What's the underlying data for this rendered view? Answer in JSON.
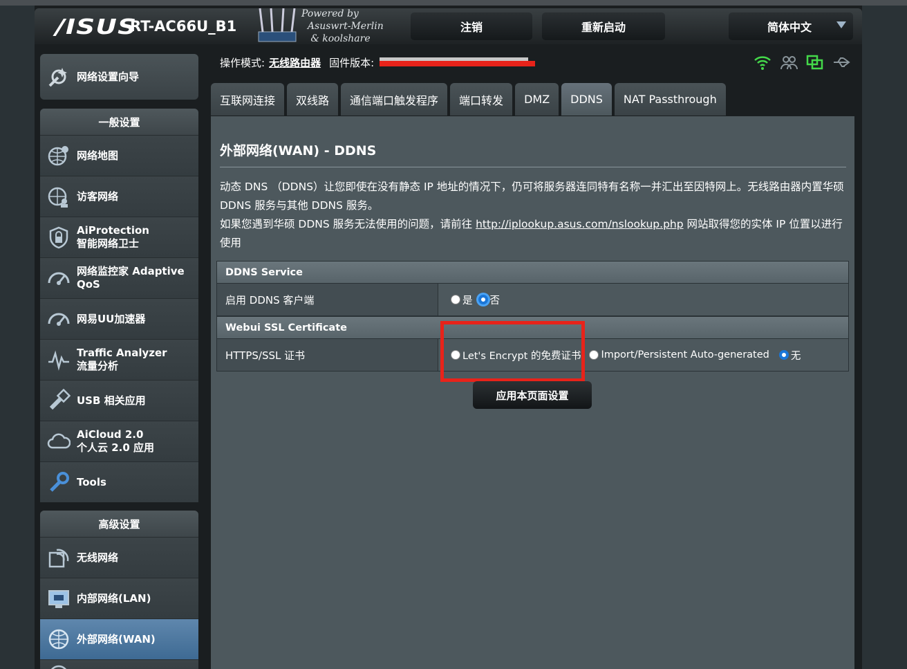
{
  "header": {
    "brand": "/ISUS",
    "model": "RT-AC66U_B1",
    "powered_by": "Powered by\n  Asuswrt-Merlin\n   & koolshare",
    "logout_label": "注销",
    "reboot_label": "重新启动",
    "language": "简体中文"
  },
  "sidebar": {
    "wizard_label": "网络设置向导",
    "general_title": "一般设置",
    "general_items": [
      {
        "label": "网络地图"
      },
      {
        "label": "访客网络"
      },
      {
        "label": "AiProtection\n智能网络卫士"
      },
      {
        "label": "网络监控家 Adaptive\nQoS"
      },
      {
        "label": "网易UU加速器"
      },
      {
        "label": "Traffic Analyzer\n流量分析"
      },
      {
        "label": "USB 相关应用"
      },
      {
        "label": "AiCloud 2.0\n个人云 2.0 应用"
      },
      {
        "label": "Tools"
      }
    ],
    "advanced_title": "高级设置",
    "advanced_items": [
      {
        "label": "无线网络"
      },
      {
        "label": "内部网络(LAN)"
      },
      {
        "label": "外部网络(WAN)",
        "active": true
      }
    ]
  },
  "status": {
    "mode_label": "操作模式:",
    "mode_value": "无线路由器",
    "firmware_label": "固件版本:"
  },
  "tabs": [
    "互联网连接",
    "双线路",
    "通信端口触发程序",
    "端口转发",
    "DMZ",
    "DDNS",
    "NAT Passthrough"
  ],
  "active_tab": "DDNS",
  "page": {
    "title": "外部网络(WAN) - DDNS",
    "desc1": "动态 DNS （DDNS）让您即使在没有静态 IP 地址的情况下，仍可将服务器连同特有名称一并汇出至因特网上。无线路由器内置华硕 DDNS 服务与其他 DDNS 服务。",
    "desc2_pre": "如果您遇到华硕 DDNS 服务无法使用的问题，请前往 ",
    "desc2_link": "http://iplookup.asus.com/nslookup.php",
    "desc2_post": " 网站取得您的实体 IP 位置以进行使用"
  },
  "ddns_section": {
    "header": "DDNS Service",
    "enable_label": "启用 DDNS 客户端",
    "opt_yes": "是",
    "opt_no": "否",
    "selected": "否"
  },
  "ssl_section": {
    "header": "Webui SSL Certificate",
    "cert_label": "HTTPS/SSL 证书",
    "opt_letsencrypt": "Let's Encrypt 的免费证书",
    "opt_import": "Import/Persistent Auto-generated",
    "opt_none": "无",
    "selected": "无"
  },
  "apply_label": "应用本页面设置",
  "colors": {
    "highlight": "#e8231a",
    "active_nav": "#4f7ba4",
    "radio_on": "#1a76d8"
  }
}
